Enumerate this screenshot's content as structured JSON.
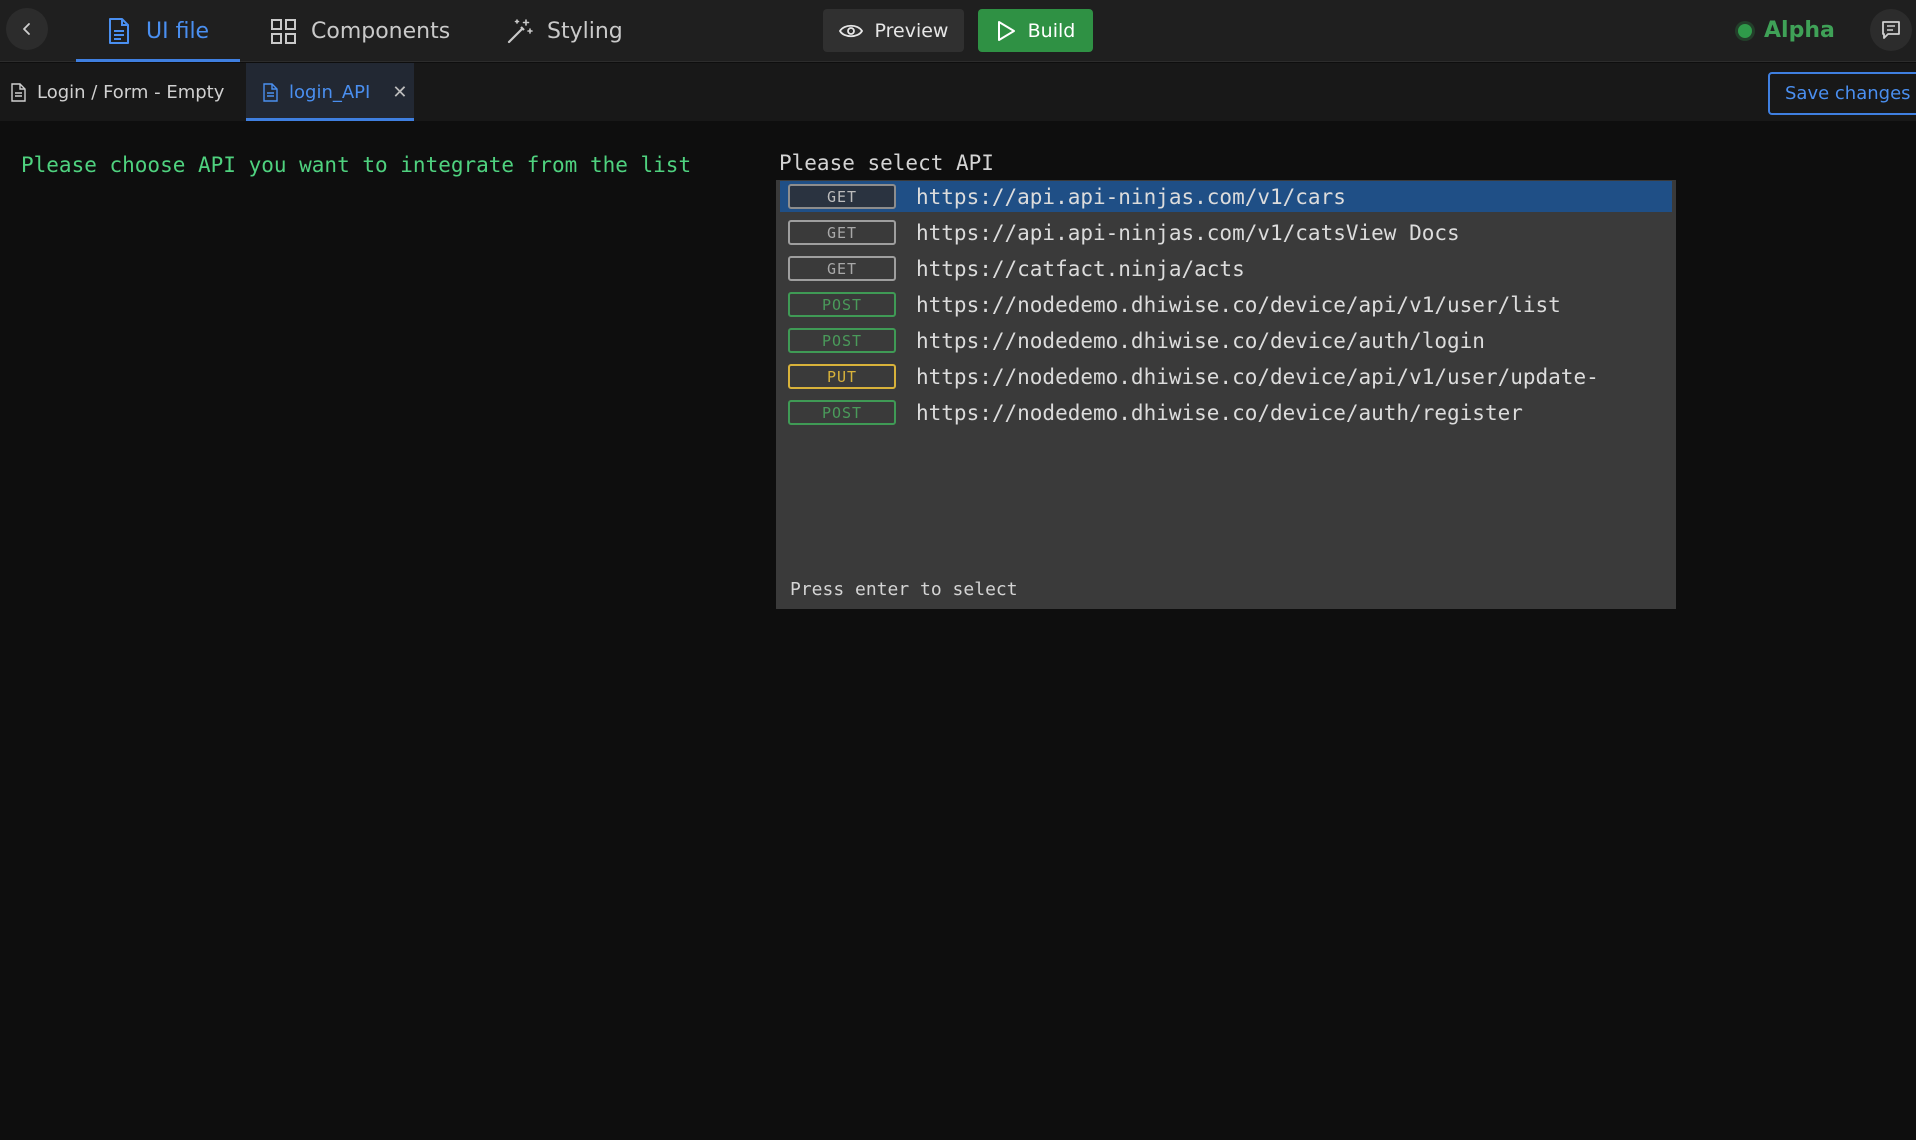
{
  "topbar": {
    "tabs": [
      {
        "label": "UI file",
        "icon": "document-icon",
        "active": true
      },
      {
        "label": "Components",
        "icon": "grid-icon",
        "active": false
      },
      {
        "label": "Styling",
        "icon": "magic-wand-icon",
        "active": false
      }
    ],
    "preview_label": "Preview",
    "build_label": "Build",
    "environment": "Alpha",
    "colors": {
      "accent": "#3f7fe0",
      "build": "#2f9144",
      "environment": "#3fa157"
    }
  },
  "file_tabs": [
    {
      "label": "Login / Form - Empty",
      "active": false
    },
    {
      "label": "login_API",
      "active": true,
      "closable": true
    }
  ],
  "save_label": "Save changes",
  "terminal": {
    "prompt": "Please choose API you want to integrate from the list",
    "select_title": "Please select API",
    "apis": [
      {
        "method": "GET",
        "url": "https://api.api-ninjas.com/v1/cars",
        "selected": true
      },
      {
        "method": "GET",
        "url": "https://api.api-ninjas.com/v1/catsView Docs"
      },
      {
        "method": "GET",
        "url": "https://catfact.ninja/acts"
      },
      {
        "method": "POST",
        "url": "https://nodedemo.dhiwise.co/device/api/v1/user/list"
      },
      {
        "method": "POST",
        "url": "https://nodedemo.dhiwise.co/device/auth/login"
      },
      {
        "method": "PUT",
        "url": "https://nodedemo.dhiwise.co/device/api/v1/user/update-"
      },
      {
        "method": "POST",
        "url": "https://nodedemo.dhiwise.co/device/auth/register"
      }
    ],
    "hint": "Press enter to select",
    "colors": {
      "prompt": "#4fd27f",
      "selected_row": "#1f4f86",
      "post": "#3f9a55",
      "put": "#d8b23a"
    }
  }
}
